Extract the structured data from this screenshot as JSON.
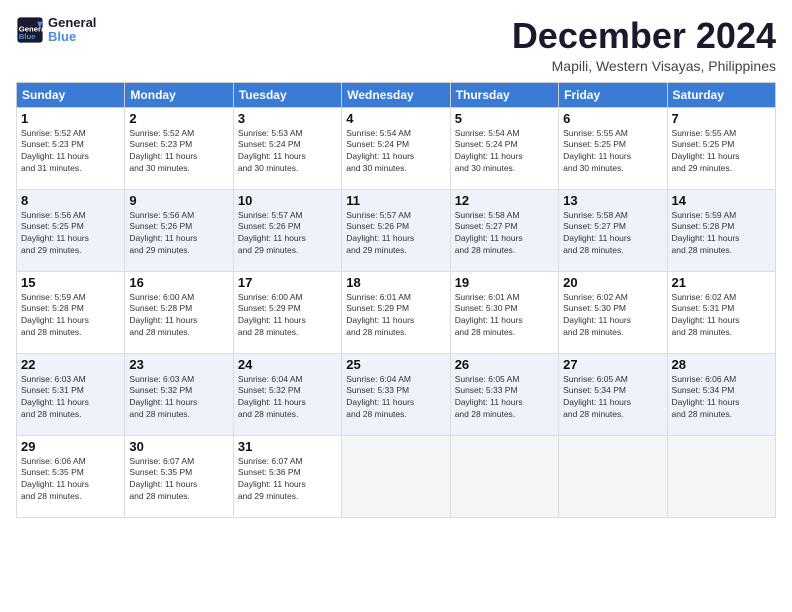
{
  "logo": {
    "text1": "General",
    "text2": "Blue"
  },
  "title": "December 2024",
  "location": "Mapili, Western Visayas, Philippines",
  "weekdays": [
    "Sunday",
    "Monday",
    "Tuesday",
    "Wednesday",
    "Thursday",
    "Friday",
    "Saturday"
  ],
  "weeks": [
    [
      {
        "day": "1",
        "info": "Sunrise: 5:52 AM\nSunset: 5:23 PM\nDaylight: 11 hours\nand 31 minutes."
      },
      {
        "day": "2",
        "info": "Sunrise: 5:52 AM\nSunset: 5:23 PM\nDaylight: 11 hours\nand 30 minutes."
      },
      {
        "day": "3",
        "info": "Sunrise: 5:53 AM\nSunset: 5:24 PM\nDaylight: 11 hours\nand 30 minutes."
      },
      {
        "day": "4",
        "info": "Sunrise: 5:54 AM\nSunset: 5:24 PM\nDaylight: 11 hours\nand 30 minutes."
      },
      {
        "day": "5",
        "info": "Sunrise: 5:54 AM\nSunset: 5:24 PM\nDaylight: 11 hours\nand 30 minutes."
      },
      {
        "day": "6",
        "info": "Sunrise: 5:55 AM\nSunset: 5:25 PM\nDaylight: 11 hours\nand 30 minutes."
      },
      {
        "day": "7",
        "info": "Sunrise: 5:55 AM\nSunset: 5:25 PM\nDaylight: 11 hours\nand 29 minutes."
      }
    ],
    [
      {
        "day": "8",
        "info": "Sunrise: 5:56 AM\nSunset: 5:25 PM\nDaylight: 11 hours\nand 29 minutes."
      },
      {
        "day": "9",
        "info": "Sunrise: 5:56 AM\nSunset: 5:26 PM\nDaylight: 11 hours\nand 29 minutes."
      },
      {
        "day": "10",
        "info": "Sunrise: 5:57 AM\nSunset: 5:26 PM\nDaylight: 11 hours\nand 29 minutes."
      },
      {
        "day": "11",
        "info": "Sunrise: 5:57 AM\nSunset: 5:26 PM\nDaylight: 11 hours\nand 29 minutes."
      },
      {
        "day": "12",
        "info": "Sunrise: 5:58 AM\nSunset: 5:27 PM\nDaylight: 11 hours\nand 28 minutes."
      },
      {
        "day": "13",
        "info": "Sunrise: 5:58 AM\nSunset: 5:27 PM\nDaylight: 11 hours\nand 28 minutes."
      },
      {
        "day": "14",
        "info": "Sunrise: 5:59 AM\nSunset: 5:28 PM\nDaylight: 11 hours\nand 28 minutes."
      }
    ],
    [
      {
        "day": "15",
        "info": "Sunrise: 5:59 AM\nSunset: 5:28 PM\nDaylight: 11 hours\nand 28 minutes."
      },
      {
        "day": "16",
        "info": "Sunrise: 6:00 AM\nSunset: 5:28 PM\nDaylight: 11 hours\nand 28 minutes."
      },
      {
        "day": "17",
        "info": "Sunrise: 6:00 AM\nSunset: 5:29 PM\nDaylight: 11 hours\nand 28 minutes."
      },
      {
        "day": "18",
        "info": "Sunrise: 6:01 AM\nSunset: 5:29 PM\nDaylight: 11 hours\nand 28 minutes."
      },
      {
        "day": "19",
        "info": "Sunrise: 6:01 AM\nSunset: 5:30 PM\nDaylight: 11 hours\nand 28 minutes."
      },
      {
        "day": "20",
        "info": "Sunrise: 6:02 AM\nSunset: 5:30 PM\nDaylight: 11 hours\nand 28 minutes."
      },
      {
        "day": "21",
        "info": "Sunrise: 6:02 AM\nSunset: 5:31 PM\nDaylight: 11 hours\nand 28 minutes."
      }
    ],
    [
      {
        "day": "22",
        "info": "Sunrise: 6:03 AM\nSunset: 5:31 PM\nDaylight: 11 hours\nand 28 minutes."
      },
      {
        "day": "23",
        "info": "Sunrise: 6:03 AM\nSunset: 5:32 PM\nDaylight: 11 hours\nand 28 minutes."
      },
      {
        "day": "24",
        "info": "Sunrise: 6:04 AM\nSunset: 5:32 PM\nDaylight: 11 hours\nand 28 minutes."
      },
      {
        "day": "25",
        "info": "Sunrise: 6:04 AM\nSunset: 5:33 PM\nDaylight: 11 hours\nand 28 minutes."
      },
      {
        "day": "26",
        "info": "Sunrise: 6:05 AM\nSunset: 5:33 PM\nDaylight: 11 hours\nand 28 minutes."
      },
      {
        "day": "27",
        "info": "Sunrise: 6:05 AM\nSunset: 5:34 PM\nDaylight: 11 hours\nand 28 minutes."
      },
      {
        "day": "28",
        "info": "Sunrise: 6:06 AM\nSunset: 5:34 PM\nDaylight: 11 hours\nand 28 minutes."
      }
    ],
    [
      {
        "day": "29",
        "info": "Sunrise: 6:06 AM\nSunset: 5:35 PM\nDaylight: 11 hours\nand 28 minutes."
      },
      {
        "day": "30",
        "info": "Sunrise: 6:07 AM\nSunset: 5:35 PM\nDaylight: 11 hours\nand 28 minutes."
      },
      {
        "day": "31",
        "info": "Sunrise: 6:07 AM\nSunset: 5:36 PM\nDaylight: 11 hours\nand 29 minutes."
      },
      {
        "day": "",
        "info": ""
      },
      {
        "day": "",
        "info": ""
      },
      {
        "day": "",
        "info": ""
      },
      {
        "day": "",
        "info": ""
      }
    ]
  ]
}
